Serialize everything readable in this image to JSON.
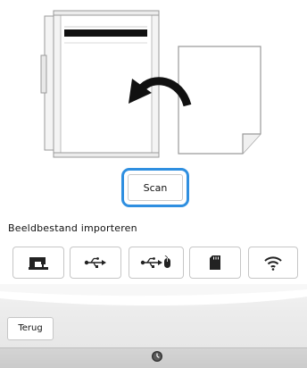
{
  "scan_button": {
    "label": "Scan"
  },
  "import_section": {
    "label": "Beeldbestand importeren"
  },
  "source_buttons": [
    {
      "icon": "machine-icon"
    },
    {
      "icon": "usb-icon"
    },
    {
      "icon": "usb-mouse-icon"
    },
    {
      "icon": "sd-card-icon"
    },
    {
      "icon": "wifi-icon"
    }
  ],
  "footer": {
    "back_label": "Terug"
  },
  "statusbar": {
    "icon": "clock-icon"
  },
  "colors": {
    "accent": "#2f8fe0",
    "button_border": "#c6c6c6"
  }
}
